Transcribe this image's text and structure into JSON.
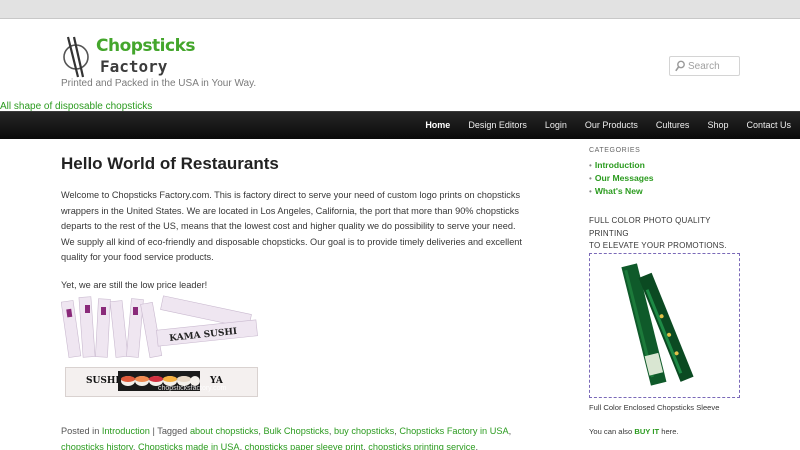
{
  "site": {
    "logo_word1": "Chopsticks",
    "logo_word2": "Factory",
    "tagline": "Printed and Packed in the USA in Your Way.",
    "banner_link": "All shape of disposable chopsticks"
  },
  "search": {
    "placeholder": "Search"
  },
  "nav": {
    "items": [
      {
        "label": "Home"
      },
      {
        "label": "Design Editors"
      },
      {
        "label": "Login"
      },
      {
        "label": "Our Products"
      },
      {
        "label": "Cultures"
      },
      {
        "label": "Shop"
      },
      {
        "label": "Contact Us"
      }
    ],
    "active": "Home"
  },
  "post": {
    "title": "Hello World of Restaurants",
    "body": "Welcome to Chopsticks Factory.com. This is factory direct to serve your need of custom logo prints on chopsticks wrappers in the United States. We are located in Los Angeles, California, the port that more than 90% chopsticks departs to the rest of the US, means that the lowest cost and higher quality we do possibility to serve your need. We supply all kind of eco-friendly and disposable chopsticks. Our goal is to provide timely deliveries and excellent quality for your food service products.",
    "tagline2": "Yet, we are still the low price leader!",
    "image": {
      "wrapper_text_1": "KAMA SUSHI",
      "wrapper_text_2": "SUSHI",
      "wrapper_text_3": "YA",
      "watermark": "chopsticksfactory.com"
    },
    "meta": {
      "posted_in": "Posted in",
      "category": "Introduction",
      "separator": "|",
      "tagged": "Tagged",
      "tags": [
        "about chopsticks",
        "Bulk Chopsticks",
        "buy chopsticks",
        "Chopsticks Factory in USA",
        "chopsticks history",
        "Chopsticks made in USA",
        "chopsticks paper sleeve print",
        "chopsticks printing service"
      ]
    }
  },
  "sidebar": {
    "categories_title": "CATEGORIES",
    "categories": [
      {
        "label": "Introduction"
      },
      {
        "label": "Our Messages"
      },
      {
        "label": "What's New"
      }
    ],
    "promo_line1": "FULL COLOR PHOTO QUALITY PRINTING",
    "promo_line2": "TO ELEVATE YOUR PROMOTIONS.",
    "sleeve_caption": "Full Color Enclosed Chopsticks Sleeve",
    "buy_prefix": "You can also",
    "buy_link": "BUY IT",
    "buy_suffix": "here."
  },
  "colors": {
    "accent_green": "#2b9b1f",
    "nav_bg": "#111111",
    "promo_border": "#7a69b8"
  }
}
